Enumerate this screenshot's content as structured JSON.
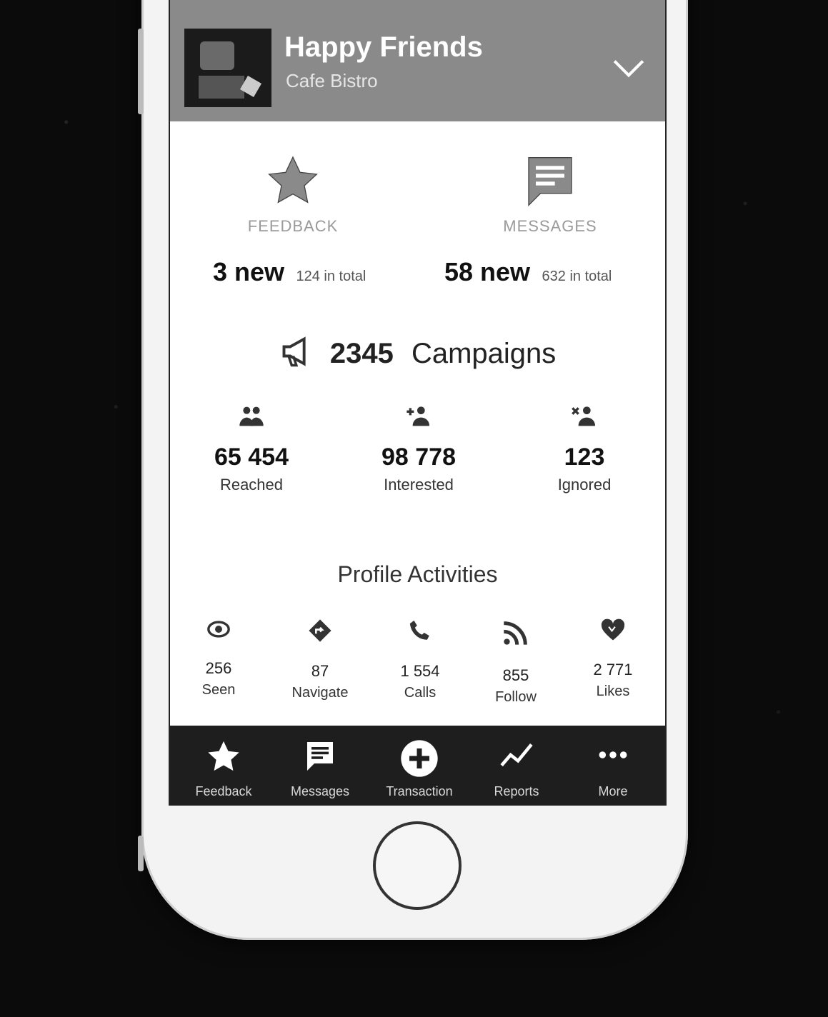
{
  "header": {
    "title": "Happy Friends",
    "subtitle": "Cafe Bistro"
  },
  "feedback": {
    "label": "FEEDBACK",
    "new_count": "3 new",
    "total": "124 in total",
    "icon": "star-icon"
  },
  "messages": {
    "label": "MESSAGES",
    "new_count": "58 new",
    "total": "632 in total",
    "icon": "message-icon"
  },
  "campaigns": {
    "count": "2345",
    "label": "Campaigns",
    "icon": "megaphone-icon"
  },
  "metrics": [
    {
      "value": "65 454",
      "label": "Reached",
      "icon": "group-icon"
    },
    {
      "value": "98 778",
      "label": "Interested",
      "icon": "add-user-icon"
    },
    {
      "value": "123",
      "label": "Ignored",
      "icon": "remove-user-icon"
    }
  ],
  "profile_activities": {
    "title": "Profile Activities",
    "items": [
      {
        "value": "256",
        "label": "Seen",
        "icon": "eye-icon"
      },
      {
        "value": "87",
        "label": "Navigate",
        "icon": "directions-icon"
      },
      {
        "value": "1 554",
        "label": "Calls",
        "icon": "phone-icon"
      },
      {
        "value": "855",
        "label": "Follow",
        "icon": "rss-icon"
      },
      {
        "value": "2 771",
        "label": "Likes",
        "icon": "heart-icon"
      }
    ]
  },
  "tabbar": [
    {
      "label": "Feedback",
      "icon": "star-icon"
    },
    {
      "label": "Messages",
      "icon": "message-icon"
    },
    {
      "label": "Transaction",
      "icon": "plus-circle-icon"
    },
    {
      "label": "Reports",
      "icon": "trend-line-icon"
    },
    {
      "label": "More",
      "icon": "more-dots-icon"
    }
  ],
  "colors": {
    "header_bg": "#8a8a8a",
    "tabbar_bg": "#1e1e1e",
    "icon_gray": "#8a8a8a"
  }
}
